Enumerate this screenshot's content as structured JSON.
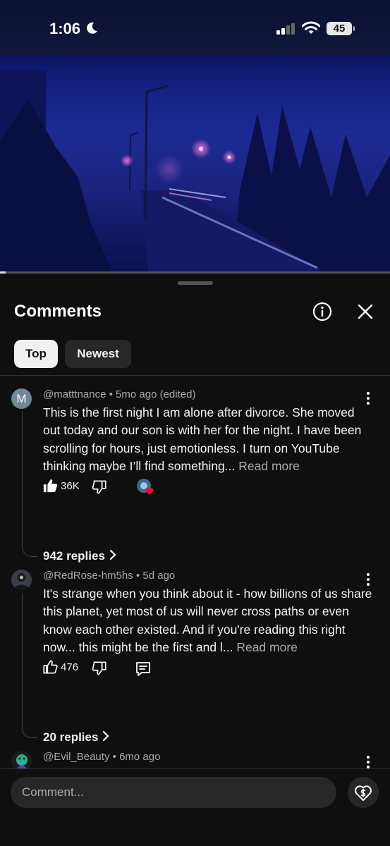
{
  "status": {
    "time": "1:06",
    "battery": "45"
  },
  "video": {
    "progress_percent": 1.5
  },
  "sheet": {
    "title": "Comments",
    "filters": [
      "Top",
      "Newest"
    ],
    "active_filter": "Top"
  },
  "comments": [
    {
      "avatar_letter": "M",
      "author": "@matttnance",
      "age": "5mo ago (edited)",
      "text": "This is the first night I am alone after divorce. She moved out today and our son is with her for the night. I have been scrolling for hours, just emotionless. I turn on YouTube thinking maybe I’ll find something...",
      "read_more": "Read more",
      "likes": "36K",
      "replies": "942 replies",
      "creator_heart": true
    },
    {
      "author": "@RedRose-hm5hs",
      "age": "5d ago",
      "text": "It's strange when you think about it - how billions of us share this planet, yet most of us will never cross paths or even know each other existed. And if you're reading this right now... this might be the first and l...",
      "read_more": "Read more",
      "likes": "476",
      "replies": "20 replies",
      "creator_heart": false
    },
    {
      "author": "@Evil_Beauty",
      "age": "6mo ago"
    }
  ],
  "meta_separator": "•",
  "composer": {
    "placeholder": "Comment..."
  },
  "icons": {
    "status": [
      "moon-icon",
      "signal-icon",
      "wifi-icon"
    ],
    "header": [
      "info-icon",
      "close-icon"
    ],
    "actions": [
      "thumb-up-icon",
      "thumb-down-icon",
      "reply-icon",
      "more-vert-icon",
      "chevron-right-icon"
    ],
    "footer": [
      "super-thanks-icon"
    ]
  },
  "colors": {
    "background": "#0f0f0f",
    "chip_active": "#f1f1f1",
    "chip_inactive": "#272727",
    "heart": "#ff0033"
  }
}
